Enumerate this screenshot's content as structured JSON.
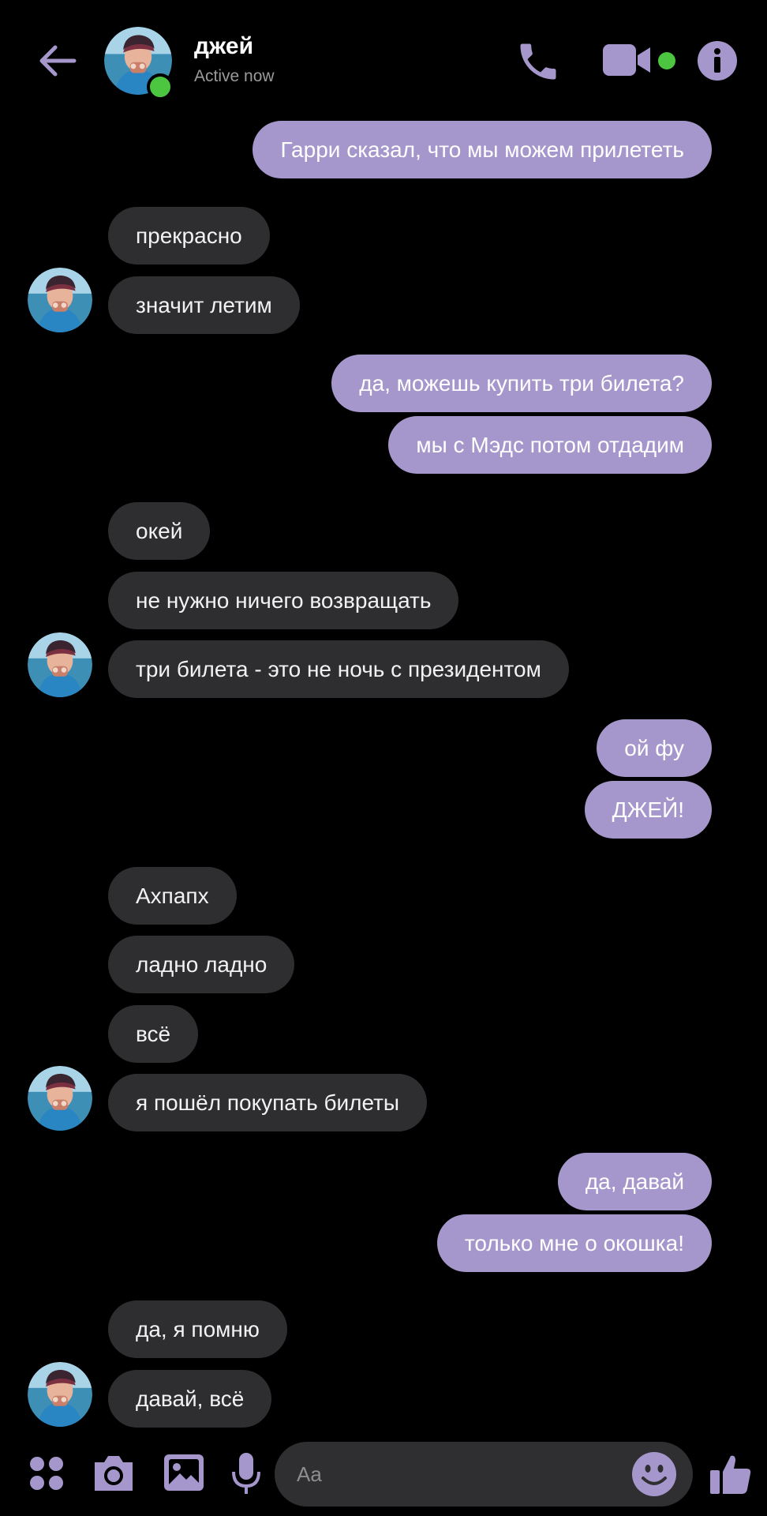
{
  "header": {
    "contact_name": "джей",
    "status": "Active now",
    "icons": [
      "back-arrow-icon",
      "phone-icon",
      "video-camera-icon",
      "info-icon"
    ],
    "accent_color": "#a597cc",
    "online_color": "#4cc641"
  },
  "messages": [
    {
      "side": "out",
      "text": "Гарри сказал, что мы можем прилететь"
    },
    {
      "side": "in",
      "text": "прекрасно"
    },
    {
      "side": "in",
      "text": "значит летим"
    },
    {
      "side": "out",
      "text": "да, можешь купить три билета?"
    },
    {
      "side": "out",
      "text": "мы с Мэдс потом отдадим"
    },
    {
      "side": "in",
      "text": "окей"
    },
    {
      "side": "in",
      "text": "не нужно ничего возвращать"
    },
    {
      "side": "in",
      "text": "три билета - это не ночь с президентом"
    },
    {
      "side": "out",
      "text": "ой фу"
    },
    {
      "side": "out",
      "text": "ДЖЕЙ!"
    },
    {
      "side": "in",
      "text": "Ахпапх"
    },
    {
      "side": "in",
      "text": "ладно ладно"
    },
    {
      "side": "in",
      "text": "всё"
    },
    {
      "side": "in",
      "text": "я пошёл покупать билеты"
    },
    {
      "side": "out",
      "text": "да, давай"
    },
    {
      "side": "out",
      "text": "только мне о окошка!"
    },
    {
      "side": "in",
      "text": "да, я помню"
    },
    {
      "side": "in",
      "text": "давай, всё"
    }
  ],
  "composer": {
    "placeholder": "Aa",
    "icons": [
      "apps-icon",
      "camera-icon",
      "gallery-icon",
      "microphone-icon",
      "emoji-icon",
      "thumbs-up-icon"
    ]
  }
}
